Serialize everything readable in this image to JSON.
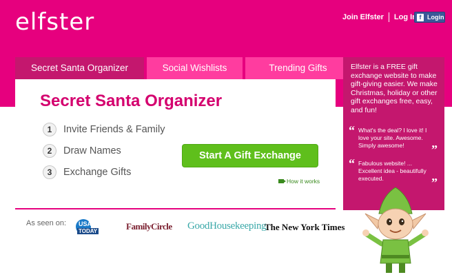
{
  "brand": {
    "logo": "elfster"
  },
  "header": {
    "join_label": "Join Elfster",
    "login_label": "Log In",
    "fb_login_label": "Login",
    "fb_icon": "f"
  },
  "tabs": [
    {
      "label": "Secret Santa Organizer",
      "active": true
    },
    {
      "label": "Social Wishlists",
      "active": false
    },
    {
      "label": "Trending Gifts",
      "active": false
    }
  ],
  "main": {
    "title": "Secret Santa Organizer",
    "steps": [
      {
        "num": "1",
        "label": "Invite Friends & Family"
      },
      {
        "num": "2",
        "label": "Draw Names"
      },
      {
        "num": "3",
        "label": "Exchange Gifts"
      }
    ],
    "cta_label": "Start A Gift Exchange",
    "how_it_works": "How it works"
  },
  "as_seen_on": {
    "label": "As seen on:",
    "usa_today_top": "USA",
    "usa_today_bottom": "TODAY",
    "family_circle": "FamilyCircle",
    "good_housekeeping": "GoodHousekeeping",
    "nyt": "The New York Times"
  },
  "sidebar": {
    "intro": "Elfster is a FREE gift exchange website to make gift-giving easier. We make Christmas, holiday or other gift exchanges free, easy, and fun!",
    "quotes": [
      "What's the deal? I love it! I love your site. Awesome. Simply awesome!",
      "Fabulous website! ... Excellent idea - beautifully executed."
    ]
  },
  "colors": {
    "brand_pink": "#e6007e",
    "tab_active": "#c4176e",
    "tab_inactive": "#ff3c9f",
    "cta_green": "#5fbf1c"
  },
  "icons": [
    "facebook-icon",
    "video-camera-icon",
    "elf-mascot"
  ]
}
